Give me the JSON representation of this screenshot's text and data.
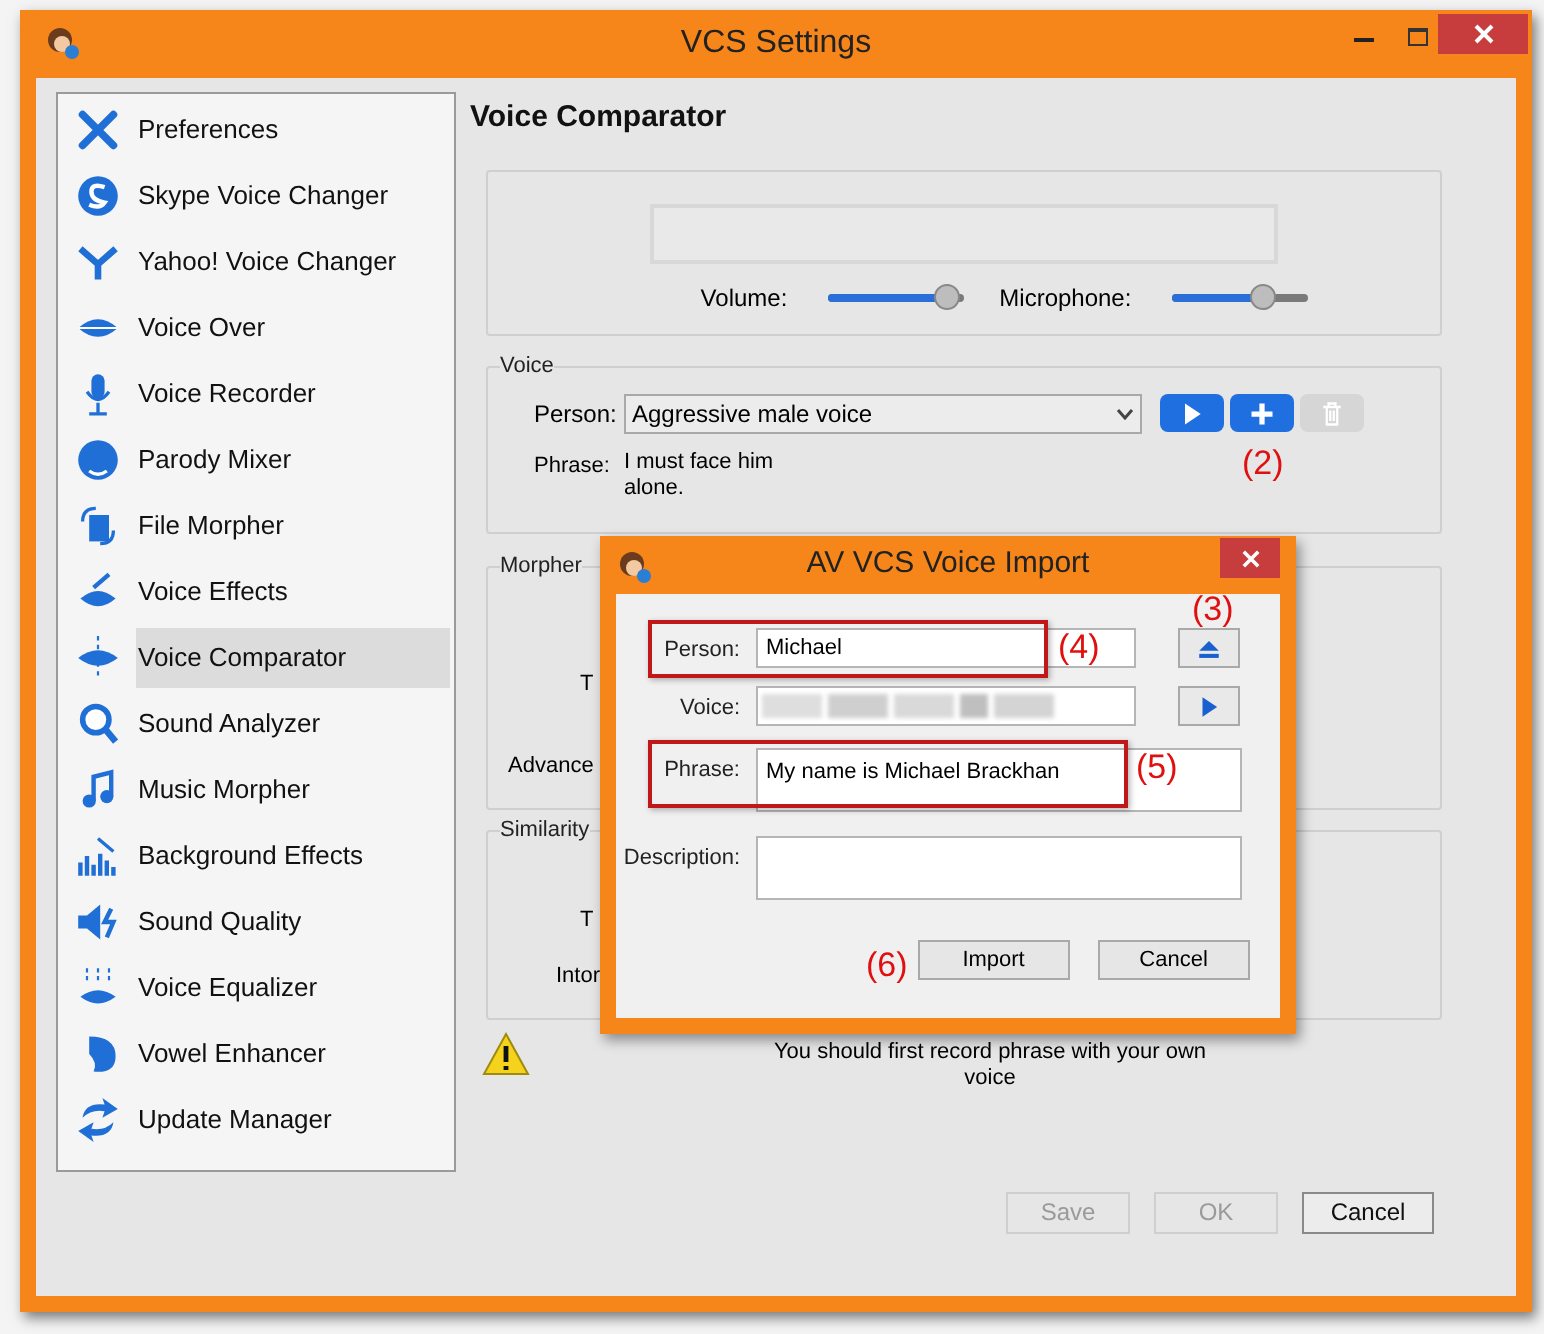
{
  "window": {
    "title": "VCS Settings"
  },
  "sidebar": {
    "items": [
      {
        "label": "Preferences",
        "selected": false
      },
      {
        "label": "Skype Voice Changer",
        "selected": false
      },
      {
        "label": "Yahoo! Voice Changer",
        "selected": false
      },
      {
        "label": "Voice Over",
        "selected": false
      },
      {
        "label": "Voice Recorder",
        "selected": false
      },
      {
        "label": "Parody Mixer",
        "selected": false
      },
      {
        "label": "File Morpher",
        "selected": false
      },
      {
        "label": "Voice Effects",
        "selected": false
      },
      {
        "label": "Voice Comparator",
        "selected": true
      },
      {
        "label": "Sound Analyzer",
        "selected": false
      },
      {
        "label": "Music Morpher",
        "selected": false
      },
      {
        "label": "Background Effects",
        "selected": false
      },
      {
        "label": "Sound Quality",
        "selected": false
      },
      {
        "label": "Voice Equalizer",
        "selected": false
      },
      {
        "label": "Vowel Enhancer",
        "selected": false
      },
      {
        "label": "Update Manager",
        "selected": false
      }
    ]
  },
  "panel": {
    "title": "Voice Comparator",
    "sliders": [
      {
        "label": "Volume:",
        "level": 0.88
      },
      {
        "label": "Microphone:",
        "level": 0.66
      }
    ],
    "voice": {
      "legend": "Voice",
      "person_label": "Person:",
      "person_value": "Aggressive male voice",
      "phrase_label": "Phrase:",
      "phrase": "I must face him alone.",
      "buttons": [
        {
          "kind": "play",
          "disabled": false
        },
        {
          "kind": "add",
          "disabled": false,
          "callout": "(2)"
        },
        {
          "kind": "delete",
          "disabled": true
        }
      ]
    },
    "morpher": {
      "legend": "Morpher",
      "labels": [
        "T",
        "Advance"
      ]
    },
    "similarity": {
      "legend": "Similarity",
      "labels": [
        "T",
        "Intor"
      ]
    },
    "warning": "You should first record phrase with your own voice",
    "buttons": [
      {
        "label": "Save",
        "disabled": true
      },
      {
        "label": "OK",
        "disabled": true
      },
      {
        "label": "Cancel",
        "disabled": false
      }
    ]
  },
  "dialog": {
    "title": "AV VCS Voice Import",
    "fields": [
      {
        "kind": "text",
        "label": "Person:",
        "value": "Michael",
        "highlighted": true,
        "callout": "(4)",
        "side_button": {
          "kind": "eject",
          "callout": "(3)"
        }
      },
      {
        "kind": "blurred",
        "label": "Voice:",
        "highlighted": false,
        "side_button": {
          "kind": "play"
        }
      },
      {
        "kind": "area",
        "label": "Phrase:",
        "value": "My name is Michael Brackhan",
        "highlighted": true,
        "callout": "(5)"
      },
      {
        "kind": "area",
        "label": "Description:",
        "highlighted": false
      }
    ],
    "buttons": [
      {
        "label": "Import",
        "callout": "(6)"
      },
      {
        "label": "Cancel"
      }
    ]
  }
}
